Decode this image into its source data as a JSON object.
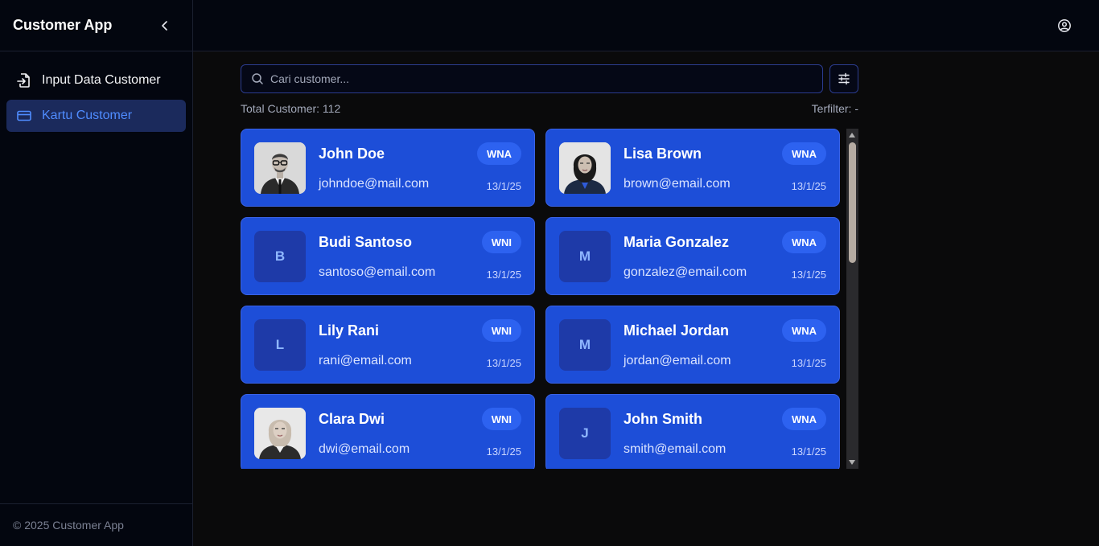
{
  "sidebar": {
    "app_title": "Customer App",
    "items": [
      {
        "label": "Input Data Customer",
        "icon": "file-import-icon",
        "active": false
      },
      {
        "label": "Kartu Customer",
        "icon": "credit-card-icon",
        "active": true
      }
    ],
    "footer": "© 2025 Customer App"
  },
  "topbar": {
    "user_icon": "user-circle-icon"
  },
  "search": {
    "placeholder": "Cari customer..."
  },
  "summary": {
    "total": "Total Customer: 112",
    "filtered": "Terfilter: -"
  },
  "customers": [
    {
      "name": "John Doe",
      "email": "johndoe@mail.com",
      "badge": "WNA",
      "date": "13/1/25",
      "avatar": "photo-man-glasses",
      "initial": ""
    },
    {
      "name": "Lisa Brown",
      "email": "brown@email.com",
      "badge": "WNA",
      "date": "13/1/25",
      "avatar": "photo-woman-hijab-dark",
      "initial": ""
    },
    {
      "name": "Budi Santoso",
      "email": "santoso@email.com",
      "badge": "WNI",
      "date": "13/1/25",
      "avatar": "initial",
      "initial": "B"
    },
    {
      "name": "Maria Gonzalez",
      "email": "gonzalez@email.com",
      "badge": "WNA",
      "date": "13/1/25",
      "avatar": "initial",
      "initial": "M"
    },
    {
      "name": "Lily Rani",
      "email": "rani@email.com",
      "badge": "WNI",
      "date": "13/1/25",
      "avatar": "initial",
      "initial": "L"
    },
    {
      "name": "Michael Jordan",
      "email": "jordan@email.com",
      "badge": "WNA",
      "date": "13/1/25",
      "avatar": "initial",
      "initial": "M"
    },
    {
      "name": "Clara Dwi",
      "email": "dwi@email.com",
      "badge": "WNI",
      "date": "13/1/25",
      "avatar": "photo-woman-hijab-light",
      "initial": ""
    },
    {
      "name": "John Smith",
      "email": "smith@email.com",
      "badge": "WNA",
      "date": "13/1/25",
      "avatar": "initial",
      "initial": "J"
    }
  ],
  "colors": {
    "card_bg": "#1d4ed8",
    "badge_bg": "#2d62f0",
    "active_nav_bg": "#1b2a5c",
    "active_nav_text": "#4f8cff",
    "sidebar_bg": "#03060f"
  }
}
